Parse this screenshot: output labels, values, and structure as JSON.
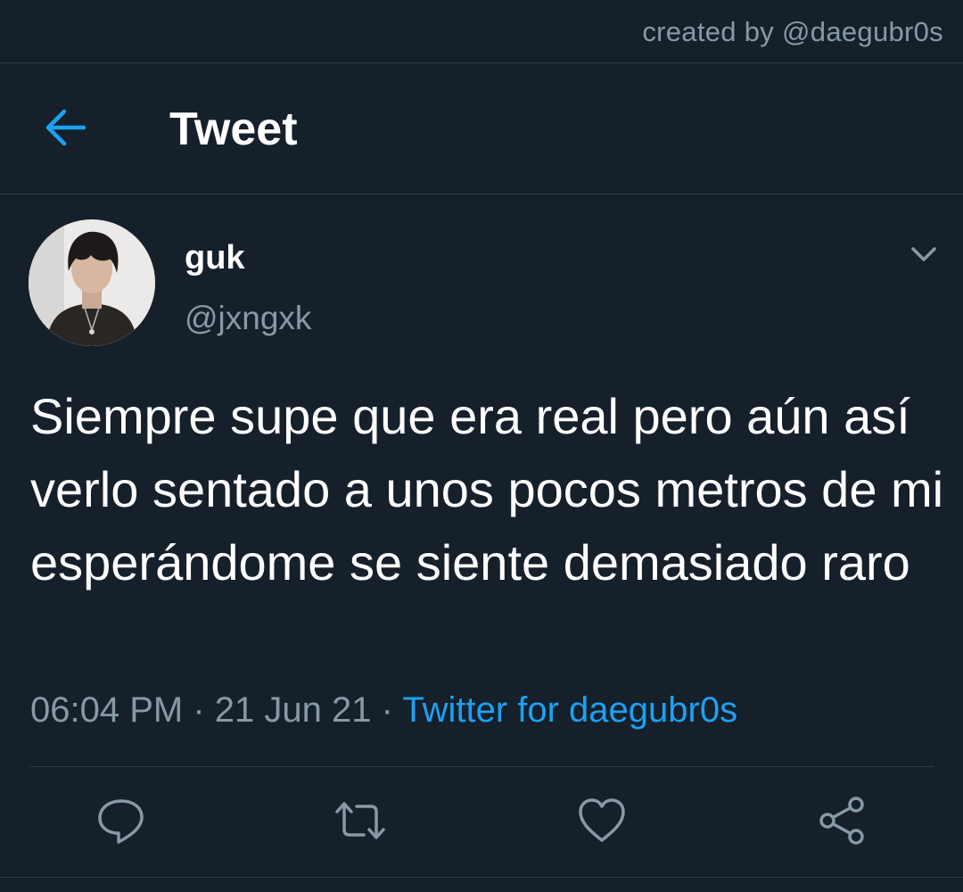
{
  "credit": "created by @daegubr0s",
  "header": {
    "title": "Tweet",
    "back_icon": "arrow-left-icon"
  },
  "tweet": {
    "display_name": "guk",
    "handle": "@jxngxk",
    "text": "Siempre supe que era real pero aún así verlo sentado a unos pocos metros de mi esperándome se siente demasiado raro",
    "time": "06:04 PM",
    "date": "21 Jun 21",
    "separator": "·",
    "source": "Twitter for daegubr0s"
  },
  "actions": [
    {
      "icon": "reply-icon"
    },
    {
      "icon": "retweet-icon"
    },
    {
      "icon": "like-icon"
    },
    {
      "icon": "share-icon"
    }
  ],
  "colors": {
    "background": "#15202b",
    "accent": "#1da1f2",
    "secondary_text": "#8899a6",
    "divider": "#2f3b47"
  }
}
